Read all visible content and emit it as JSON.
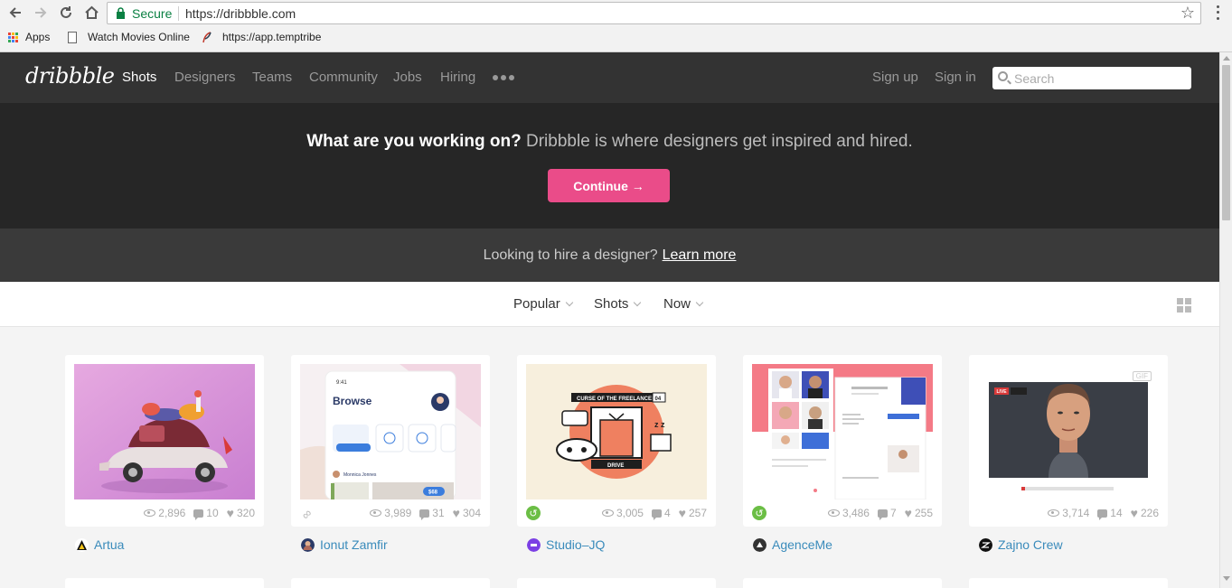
{
  "browser": {
    "secure_label": "Secure",
    "url": "https://dribbble.com",
    "bookmarks": [
      {
        "label": "Apps",
        "icon": "apps-grid-icon"
      },
      {
        "label": "Watch Movies Online",
        "icon": "page-icon"
      },
      {
        "label": "https://app.temptribe",
        "icon": "feather-icon"
      }
    ]
  },
  "header": {
    "logo": "dribbble",
    "nav": [
      "Shots",
      "Designers",
      "Teams",
      "Community",
      "Jobs",
      "Hiring"
    ],
    "active_nav": "Shots",
    "sign_up": "Sign up",
    "sign_in": "Sign in",
    "search_placeholder": "Search"
  },
  "hero": {
    "strong": "What are you working on?",
    "rest": " Dribbble is where designers get inspired and hired.",
    "button": "Continue →"
  },
  "hire": {
    "text": "Looking to hire a designer?",
    "link": "Learn more"
  },
  "filters": {
    "sort": "Popular",
    "type": "Shots",
    "time": "Now"
  },
  "shots": [
    {
      "author": "Artua",
      "views": "2,896",
      "comments": "10",
      "likes": "320",
      "badge": "none"
    },
    {
      "author": "Ionut Zamfir",
      "views": "3,989",
      "comments": "31",
      "likes": "304",
      "badge": "attachment"
    },
    {
      "author": "Studio–JQ",
      "views": "3,005",
      "comments": "4",
      "likes": "257",
      "badge": "rebound"
    },
    {
      "author": "AgenceMe",
      "views": "3,486",
      "comments": "7",
      "likes": "255",
      "badge": "rebound"
    },
    {
      "author": "Zajno Crew",
      "views": "3,714",
      "comments": "14",
      "likes": "226",
      "badge": "none"
    }
  ],
  "shot_art": {
    "browse_title": "Browse",
    "browse_time": "9:41",
    "browse_user": "Monnica Jonnes",
    "browse_price": "$68",
    "freelancer_title": "CURSE OF THE FREELANCER",
    "freelancer_sub": "DRIVE",
    "freelancer_num": "04",
    "live": "LIVE",
    "gif": "GIF"
  },
  "colors": {
    "brand_pink": "#ea4c89",
    "header_bg": "#333333",
    "hero_bg": "#262626",
    "link_blue": "#3a8bbb",
    "secure_green": "#0b8043"
  }
}
